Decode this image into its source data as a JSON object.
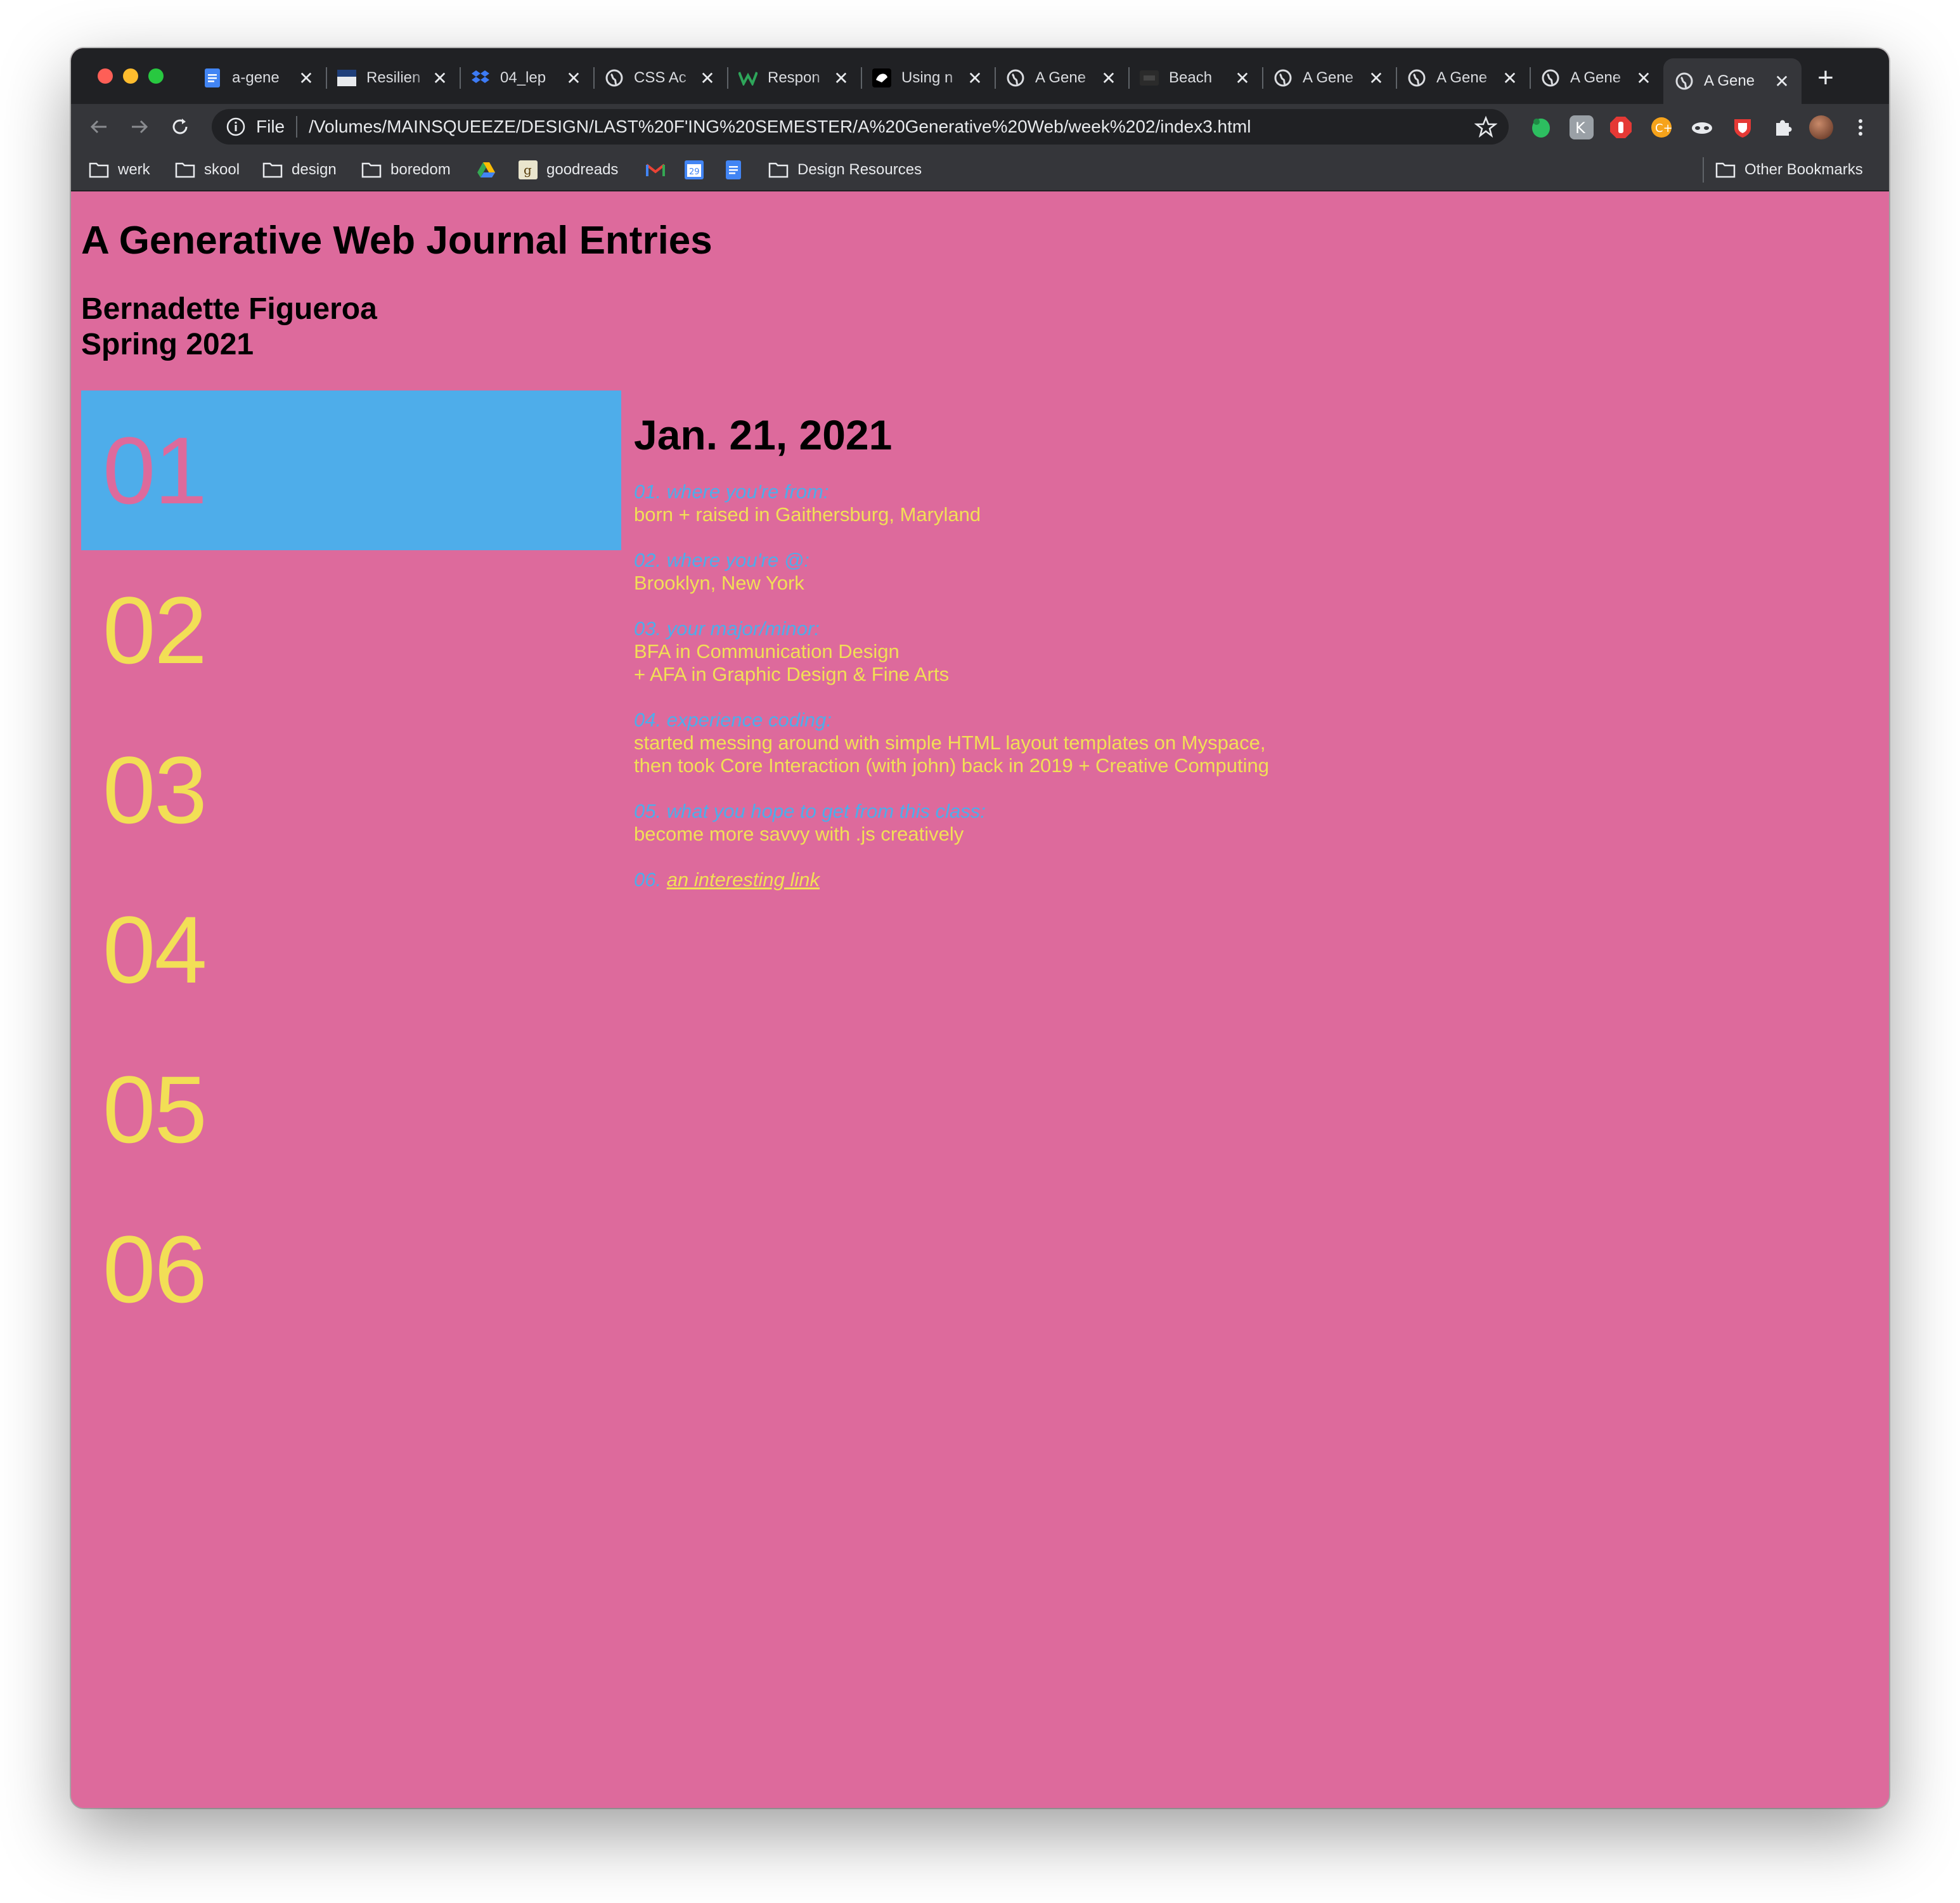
{
  "browser": {
    "tabs": [
      {
        "title": "a-gene",
        "favicon": "google-docs-icon"
      },
      {
        "title": "Resilien",
        "favicon": "page-thumbnail-icon"
      },
      {
        "title": "04_lep",
        "favicon": "dropbox-icon"
      },
      {
        "title": "CSS Ac",
        "favicon": "globe-icon"
      },
      {
        "title": "Respon",
        "favicon": "w-logo-icon"
      },
      {
        "title": "Using n",
        "favicon": "dark-logo-icon"
      },
      {
        "title": "A Gene",
        "favicon": "globe-icon"
      },
      {
        "title": "Beach",
        "favicon": "dark-logo-icon"
      },
      {
        "title": "A Gene",
        "favicon": "globe-icon"
      },
      {
        "title": "A Gene",
        "favicon": "globe-icon"
      },
      {
        "title": "A Gene",
        "favicon": "globe-icon"
      },
      {
        "title": "A Gene",
        "favicon": "globe-icon",
        "active": true
      }
    ],
    "close_glyph": "✕",
    "new_tab_glyph": "+",
    "address": {
      "scheme": "File",
      "url": "/Volumes/MAINSQUEEZE/DESIGN/LAST%20F'ING%20SEMESTER/A%20Generative%20Web/week%202/index3.html"
    },
    "bookmarks": [
      {
        "label": "werk",
        "icon": "folder-icon"
      },
      {
        "label": "skool",
        "icon": "folder-icon"
      },
      {
        "label": "design",
        "icon": "folder-icon"
      },
      {
        "label": "boredom",
        "icon": "folder-icon"
      },
      {
        "label": "",
        "icon": "google-drive-icon"
      },
      {
        "label": "goodreads",
        "icon": "goodreads-icon"
      },
      {
        "label": "",
        "icon": "gmail-icon"
      },
      {
        "label": "",
        "icon": "google-calendar-icon"
      },
      {
        "label": "",
        "icon": "google-docs-icon"
      },
      {
        "label": "Design Resources",
        "icon": "folder-icon"
      }
    ],
    "other_bookmarks": "Other Bookmarks"
  },
  "page": {
    "title": "A Generative Web Journal Entries",
    "author": "Bernadette Figueroa",
    "term": "Spring 2021",
    "entry_numbers": [
      "01",
      "02",
      "03",
      "04",
      "05",
      "06"
    ],
    "active_entry": "01",
    "entry": {
      "date": "Jan. 21, 2021",
      "items": [
        {
          "q": "01. where you're from:",
          "a": [
            "born + raised in Gaithersburg, Maryland"
          ]
        },
        {
          "q": "02. where you're @:",
          "a": [
            "Brooklyn, New York"
          ]
        },
        {
          "q": "03. your major/minor:",
          "a": [
            "BFA in Communication Design",
            "+ AFA in Graphic Design & Fine Arts"
          ]
        },
        {
          "q": "04. experience coding:",
          "a": [
            "started messing around with simple HTML layout templates on Myspace,",
            "then took Core Interaction (with john) back in 2019 + Creative Computing"
          ]
        },
        {
          "q": "05. what you hope to get from this class:",
          "a": [
            "become more savvy with .js creatively"
          ]
        }
      ],
      "link_prefix": "06.",
      "link_label": "an interesting link"
    }
  },
  "colors": {
    "page_bg": "#dd6a9c",
    "accent_blue": "#4eadea",
    "accent_yellow": "#f2df56"
  }
}
